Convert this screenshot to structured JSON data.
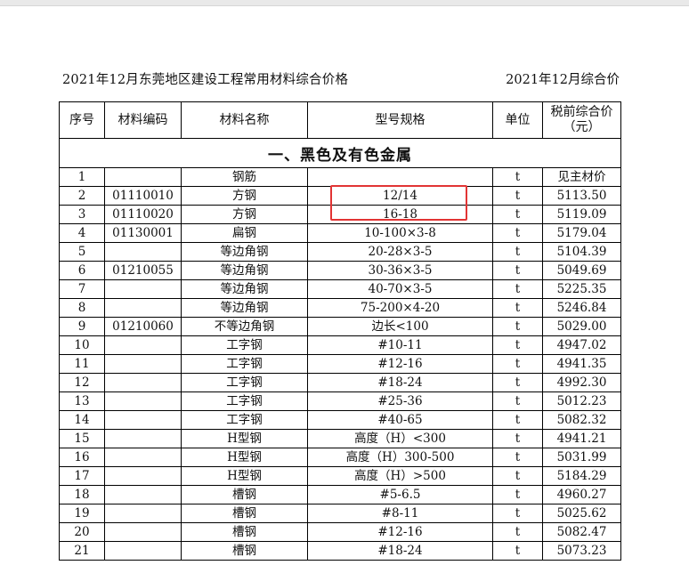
{
  "document": {
    "title": "2021年12月东莞地区建设工程常用材料综合价格",
    "right_label": "2021年12月综合价"
  },
  "table": {
    "headers": [
      "序号",
      "材料编码",
      "材料名称",
      "型号规格",
      "单位",
      "税前综合价",
      "（元）"
    ],
    "section_title": "一、黑色及有色金属",
    "rows": [
      {
        "no": "1",
        "code": "",
        "name": "钢筋",
        "spec": "",
        "unit": "t",
        "price": "见主材价"
      },
      {
        "no": "2",
        "code": "01110010",
        "name": "方钢",
        "spec": "12/14",
        "unit": "t",
        "price": "5113.50"
      },
      {
        "no": "3",
        "code": "01110020",
        "name": "方钢",
        "spec": "16-18",
        "unit": "t",
        "price": "5119.09"
      },
      {
        "no": "4",
        "code": "01130001",
        "name": "扁钢",
        "spec": "10-100×3-8",
        "unit": "t",
        "price": "5179.04"
      },
      {
        "no": "5",
        "code": "",
        "name": "等边角钢",
        "spec": "20-28×3-5",
        "unit": "t",
        "price": "5104.39"
      },
      {
        "no": "6",
        "code": "01210055",
        "name": "等边角钢",
        "spec": "30-36×3-5",
        "unit": "t",
        "price": "5049.69"
      },
      {
        "no": "7",
        "code": "",
        "name": "等边角钢",
        "spec": "40-70×3-5",
        "unit": "t",
        "price": "5225.35"
      },
      {
        "no": "8",
        "code": "",
        "name": "等边角钢",
        "spec": "75-200×4-20",
        "unit": "t",
        "price": "5246.84"
      },
      {
        "no": "9",
        "code": "01210060",
        "name": "不等边角钢",
        "spec": "边长<100",
        "unit": "t",
        "price": "5029.00"
      },
      {
        "no": "10",
        "code": "",
        "name": "工字钢",
        "spec": "#10-11",
        "unit": "t",
        "price": "4947.02"
      },
      {
        "no": "11",
        "code": "",
        "name": "工字钢",
        "spec": "#12-16",
        "unit": "t",
        "price": "4941.35"
      },
      {
        "no": "12",
        "code": "",
        "name": "工字钢",
        "spec": "#18-24",
        "unit": "t",
        "price": "4992.30"
      },
      {
        "no": "13",
        "code": "",
        "name": "工字钢",
        "spec": "#25-36",
        "unit": "t",
        "price": "5012.23"
      },
      {
        "no": "14",
        "code": "",
        "name": "工字钢",
        "spec": "#40-65",
        "unit": "t",
        "price": "5082.32"
      },
      {
        "no": "15",
        "code": "",
        "name": "H型钢",
        "spec": "高度（H）<300",
        "unit": "t",
        "price": "4941.21"
      },
      {
        "no": "16",
        "code": "",
        "name": "H型钢",
        "spec": "高度（H）300-500",
        "unit": "t",
        "price": "5031.99"
      },
      {
        "no": "17",
        "code": "",
        "name": "H型钢",
        "spec": "高度（H）>500",
        "unit": "t",
        "price": "5184.29"
      },
      {
        "no": "18",
        "code": "",
        "name": "槽钢",
        "spec": "#5-6.5",
        "unit": "t",
        "price": "4960.27"
      },
      {
        "no": "19",
        "code": "",
        "name": "槽钢",
        "spec": "#8-11",
        "unit": "t",
        "price": "5025.62"
      },
      {
        "no": "20",
        "code": "",
        "name": "槽钢",
        "spec": "#12-16",
        "unit": "t",
        "price": "5082.47"
      },
      {
        "no": "21",
        "code": "",
        "name": "槽钢",
        "spec": "#18-24",
        "unit": "t",
        "price": "5073.23"
      }
    ]
  },
  "colors": {
    "highlight_border": "#e23434",
    "table_border": "#000000",
    "topbar": "#e9e9e9"
  }
}
